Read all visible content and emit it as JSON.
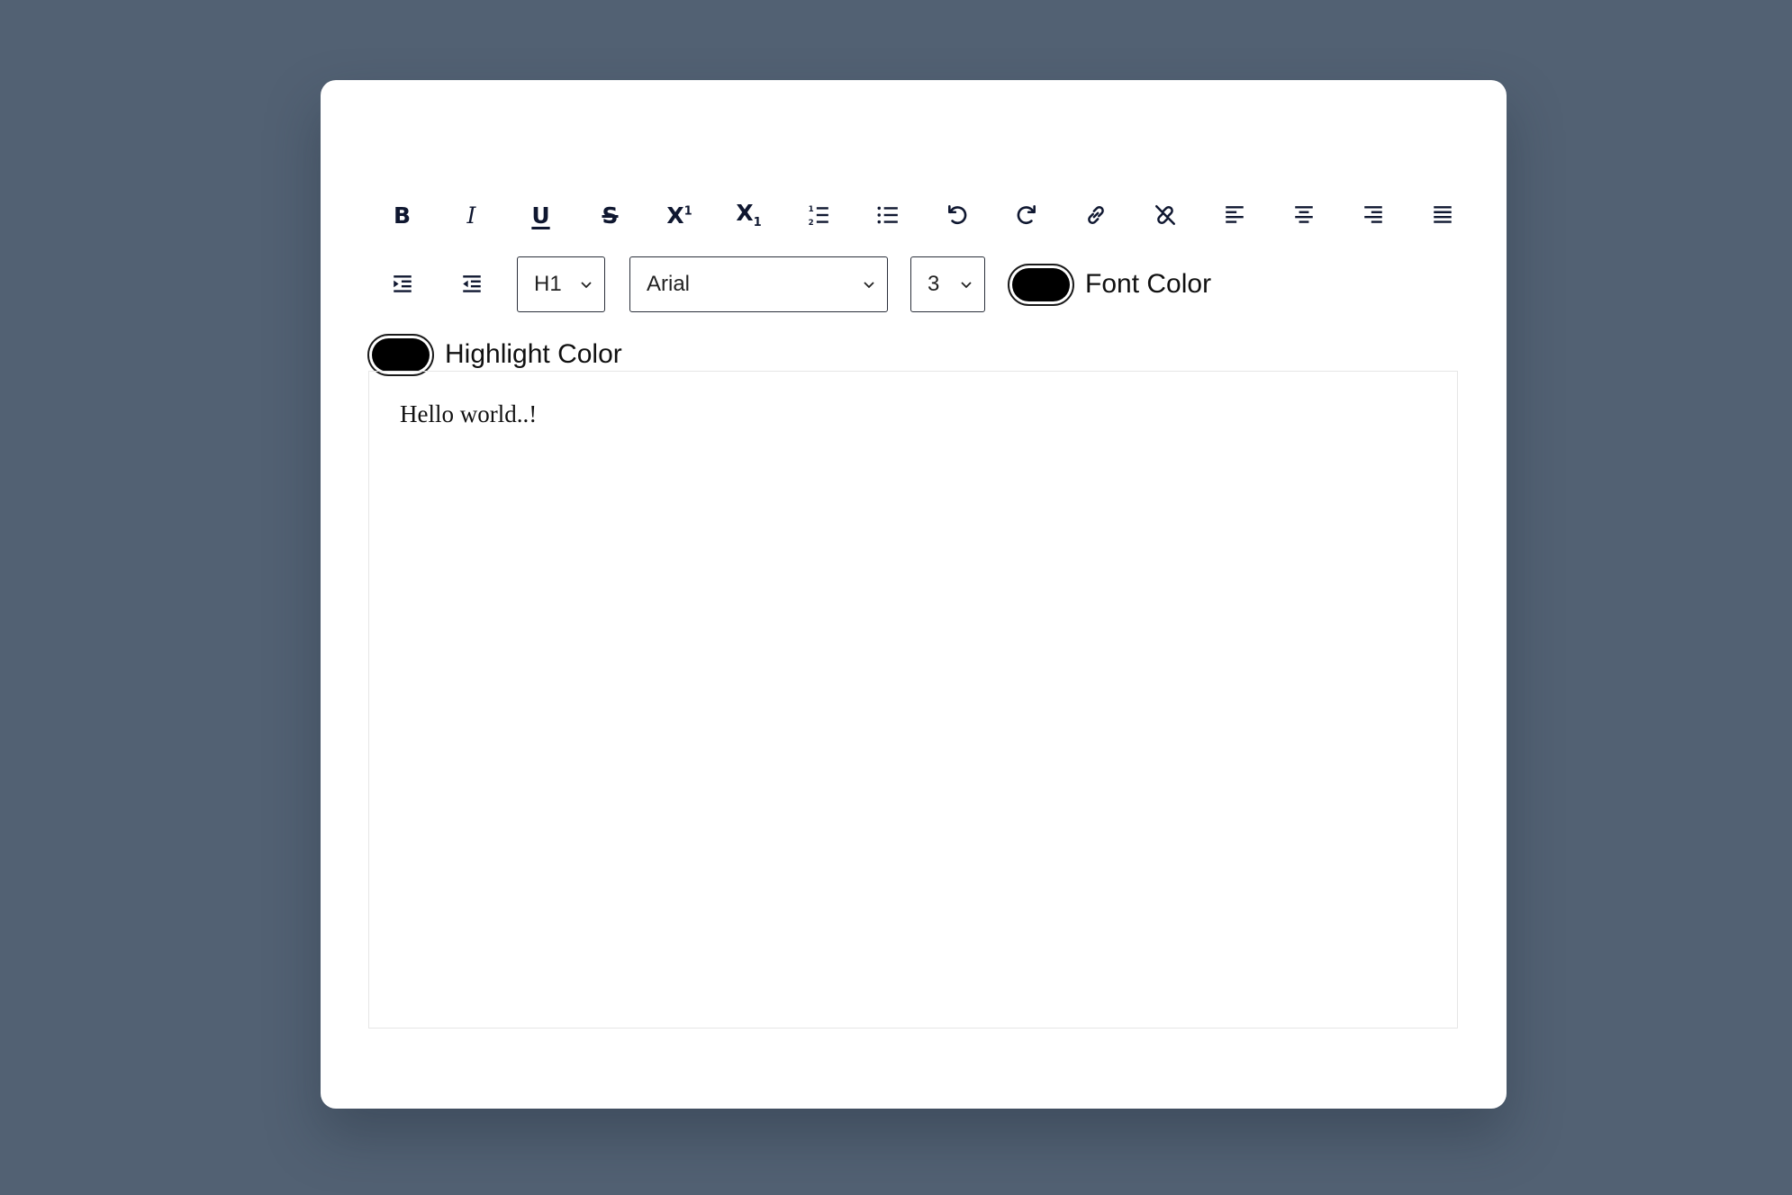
{
  "toolbar": {
    "buttons": [
      {
        "icon": "bold-icon"
      },
      {
        "icon": "italic-icon"
      },
      {
        "icon": "underline-icon"
      },
      {
        "icon": "strikethrough-icon"
      },
      {
        "icon": "superscript-icon"
      },
      {
        "icon": "subscript-icon"
      },
      {
        "icon": "ordered-list-icon"
      },
      {
        "icon": "unordered-list-icon"
      },
      {
        "icon": "undo-icon"
      },
      {
        "icon": "redo-icon"
      },
      {
        "icon": "link-icon"
      },
      {
        "icon": "unlink-icon"
      },
      {
        "icon": "align-left-icon"
      },
      {
        "icon": "align-center-icon"
      },
      {
        "icon": "align-right-icon"
      },
      {
        "icon": "align-justify-icon"
      },
      {
        "icon": "indent-icon"
      },
      {
        "icon": "outdent-icon"
      }
    ],
    "glyphs": {
      "bold": "B",
      "italic": "I",
      "underline": "U",
      "strike": "S",
      "superscript_base": "X",
      "superscript_exp": "1",
      "subscript_base": "X",
      "subscript_exp": "1"
    },
    "heading_select": {
      "value": "H1"
    },
    "font_select": {
      "value": "Arial"
    },
    "size_select": {
      "value": "3"
    },
    "font_color": {
      "label": "Font Color",
      "value": "#000000"
    },
    "highlight_color": {
      "label": "Highlight Color",
      "value": "#000000"
    }
  },
  "editor": {
    "content": "Hello world..!"
  },
  "colors": {
    "background": "#526173",
    "card": "#ffffff",
    "icon": "#0f1730"
  }
}
